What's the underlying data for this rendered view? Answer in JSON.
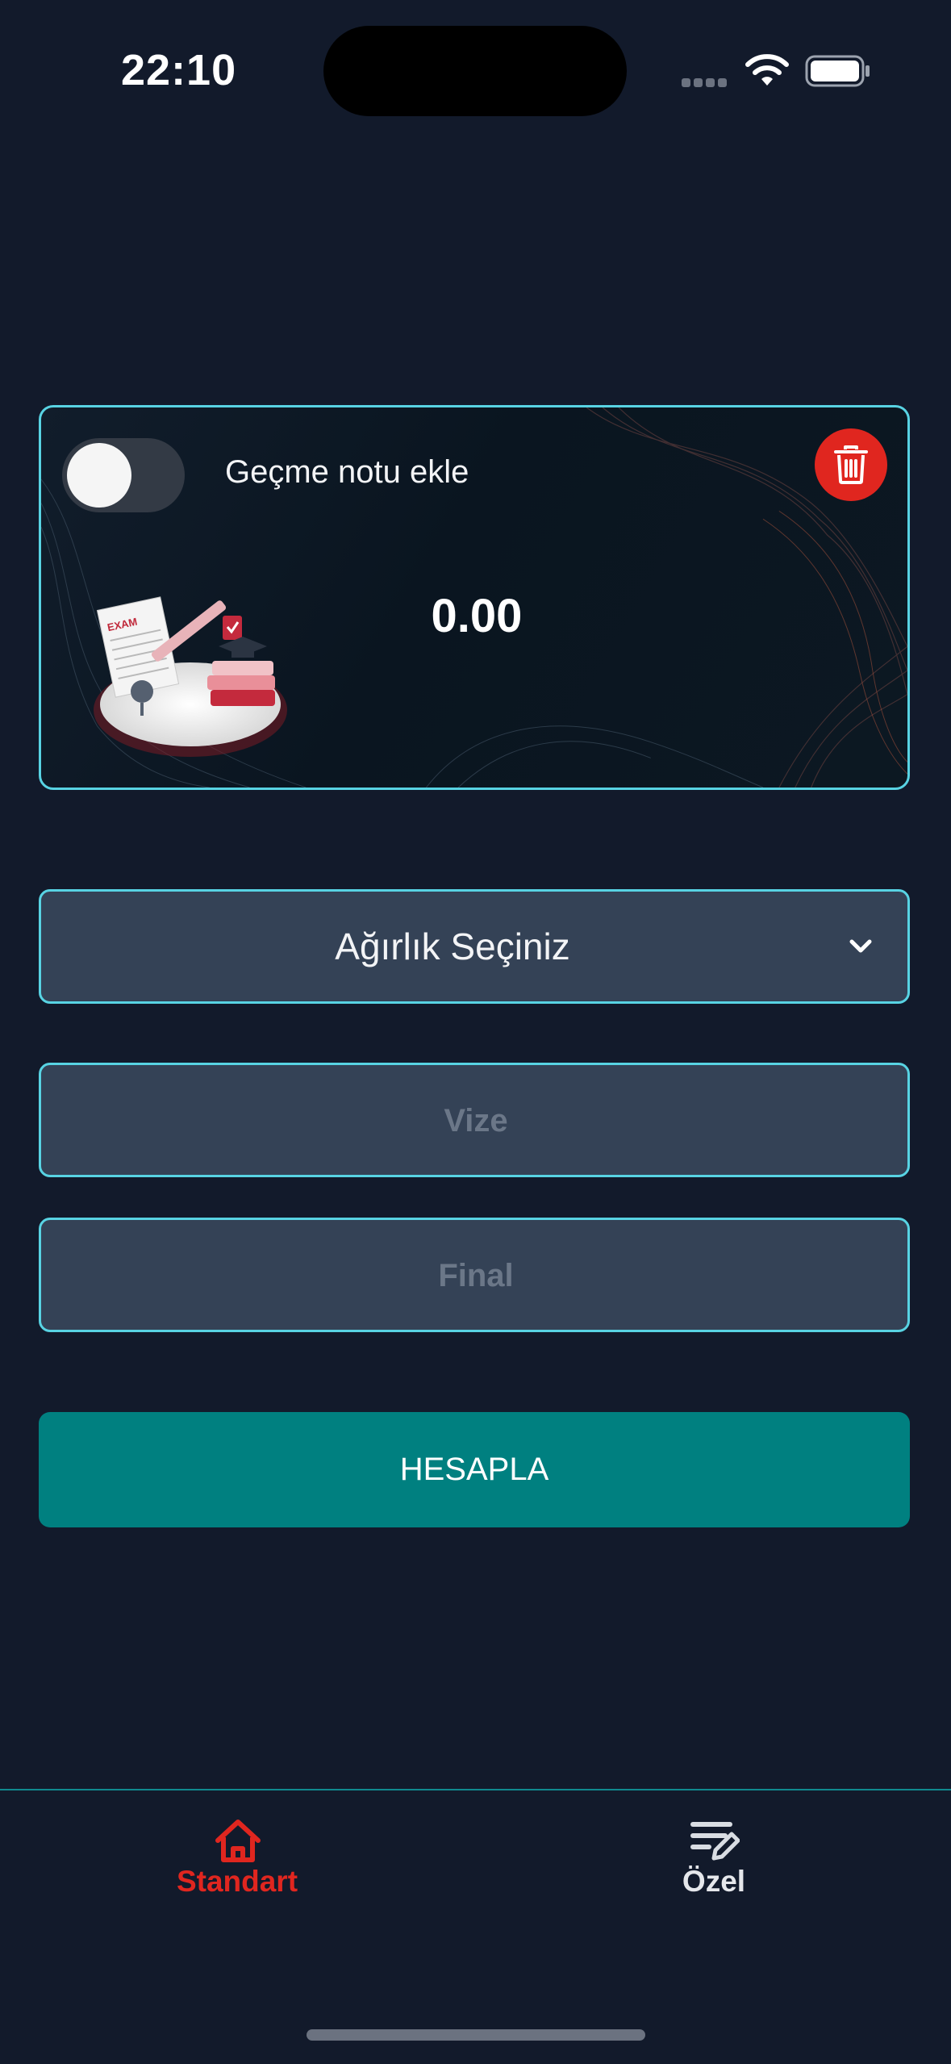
{
  "status_bar": {
    "time": "22:10"
  },
  "card": {
    "toggle_label": "Geçme notu ekle",
    "toggle_on": false,
    "result": "0.00",
    "illustration_text": "EXAM"
  },
  "form": {
    "weight_select": "Ağırlık Seçiniz",
    "vize_placeholder": "Vize",
    "final_placeholder": "Final",
    "calculate_label": "HESAPLA"
  },
  "tabbar": {
    "tabs": [
      {
        "label": "Standart",
        "icon": "home-icon",
        "active": true
      },
      {
        "label": "Özel",
        "icon": "edit-list-icon",
        "active": false
      }
    ]
  },
  "colors": {
    "background": "#121a2b",
    "accent_border": "#58d3e3",
    "button": "#008080",
    "danger": "#e0261f",
    "active_tab": "#e0261f",
    "field": "#344256"
  }
}
